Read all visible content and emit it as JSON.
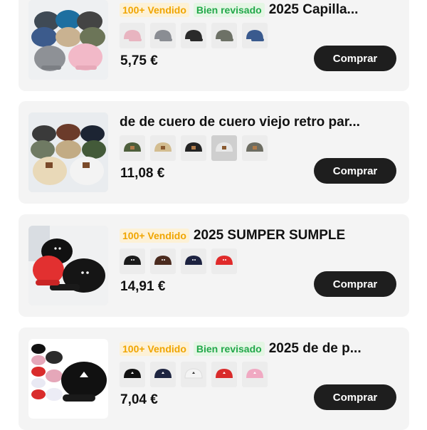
{
  "products": [
    {
      "badges": [
        {
          "text": "100+ Vendido",
          "kind": "sold"
        },
        {
          "text": "Bien revisado",
          "kind": "review"
        }
      ],
      "title": "2025 Capilla...",
      "price": "5,75 €",
      "buy_label": "Comprar",
      "swatch_colors": [
        "#e8b4c0",
        "#8a8d93",
        "#2a2a2a",
        "#6d7166",
        "#3a5a8e"
      ],
      "thumb_colors": [
        "#3f4a55",
        "#1d6fa0",
        "#444",
        "#3c5b8c",
        "#c9b291",
        "#6c7558",
        "#8e9196",
        "#f2b9c8"
      ]
    },
    {
      "badges": [],
      "title": "de de cuero de cuero viejo retro par...",
      "price": "11,08 €",
      "buy_label": "Comprar",
      "swatch_colors": [
        "#4d5e3b",
        "#d3bd90",
        "#222222",
        "#e8e8e8",
        "#6d6d62"
      ],
      "thumb_colors": [
        "#3a3a3a",
        "#6b3b2a",
        "#1c2433",
        "#6f7a63",
        "#c2ab84",
        "#435a39",
        "#e9d9b8",
        "#f3f3f3"
      ]
    },
    {
      "badges": [
        {
          "text": "100+ Vendido",
          "kind": "sold"
        }
      ],
      "title": "2025 SUMPER SUMPLE",
      "price": "14,91 €",
      "buy_label": "Comprar",
      "swatch_colors": [
        "#1a1a1a",
        "#4a2a1e",
        "#1c2240",
        "#e02a2a"
      ],
      "thumb_colors": [
        "#111111",
        "#e23030",
        "#151515"
      ]
    },
    {
      "badges": [
        {
          "text": "100+ Vendido",
          "kind": "sold"
        },
        {
          "text": "Bien revisado",
          "kind": "review"
        }
      ],
      "title": "2025 de de p...",
      "price": "7,04 €",
      "buy_label": "Comprar",
      "swatch_colors": [
        "#111111",
        "#1d2440",
        "#f4f4f4",
        "#d92b2b",
        "#f0a9c2"
      ],
      "thumb_colors": [
        "#111111",
        "#e5a7b9",
        "#d92b2b",
        "#e9e9f3",
        "#2b2b2b"
      ]
    }
  ]
}
